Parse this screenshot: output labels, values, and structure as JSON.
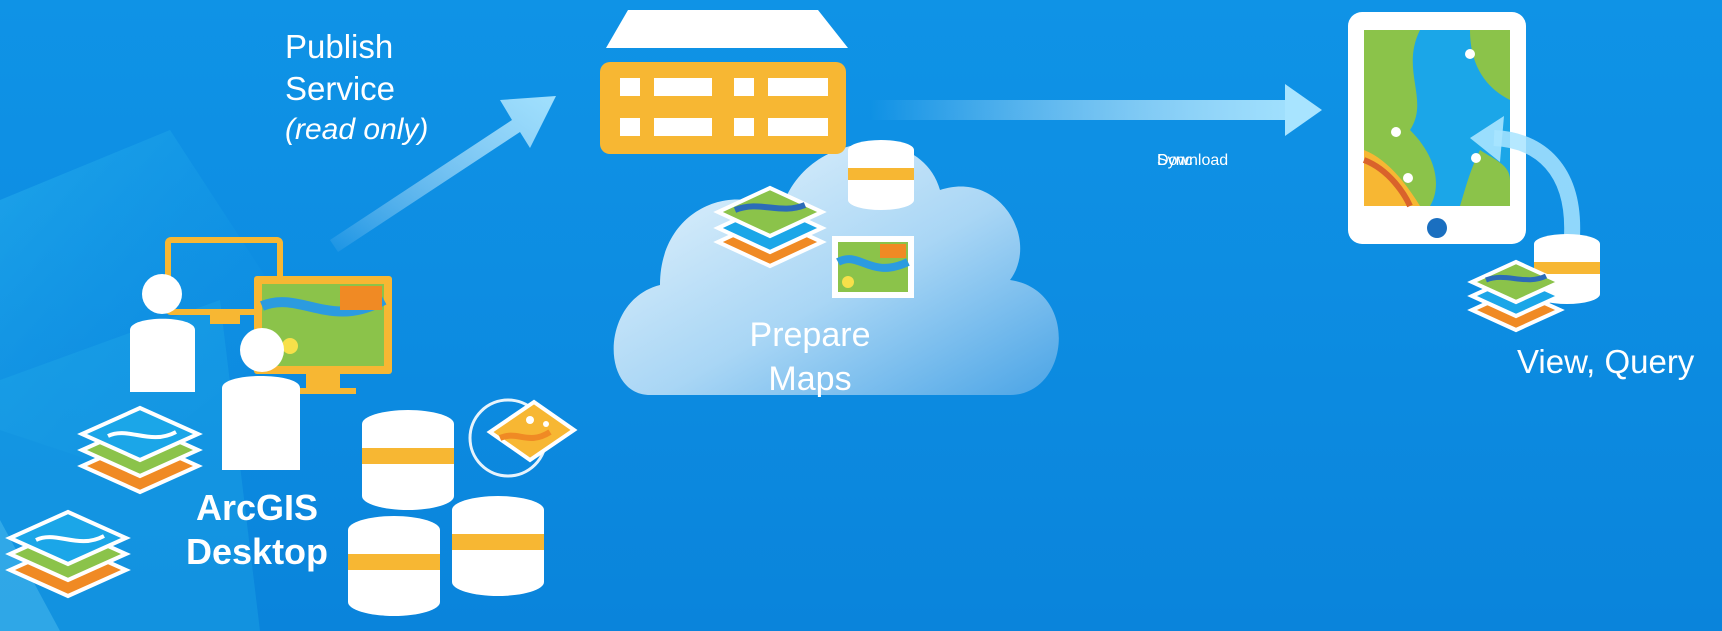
{
  "labels": {
    "publish_line1": "Publish",
    "publish_line2": "Service",
    "publish_note": "(read only)",
    "prepare_line1": "Prepare",
    "prepare_line2": "Maps",
    "sync_a": "Download",
    "sync_b": "Sync",
    "view": "View, Query",
    "desktop_line1": "ArcGIS",
    "desktop_line2": "Desktop"
  },
  "icons": [
    "server-icon",
    "cloud-icon",
    "database-icon",
    "map-layers-icon",
    "map-thumbnail-icon",
    "tablet-icon",
    "monitor-icon",
    "person-icon",
    "sync-arrow-icon",
    "publish-arrow-icon"
  ],
  "colors": {
    "background": "#0d8de2",
    "accent": "#f7b733",
    "cloud": "#dceefb",
    "text": "#ffffff"
  }
}
